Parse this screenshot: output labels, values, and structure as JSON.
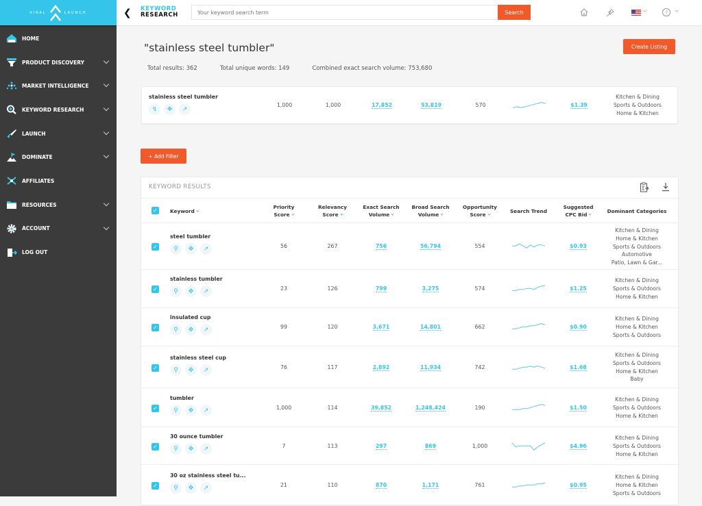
{
  "brand": {
    "logo_text_left": "VIRAL",
    "logo_text_right": "LAUNCH",
    "accent": "#36c5ea",
    "orange": "#f05a2a"
  },
  "sidebar": {
    "items": [
      {
        "label": "HOME",
        "icon": "home-icon",
        "has_children": false
      },
      {
        "label": "PRODUCT DISCOVERY",
        "icon": "funnel-icon",
        "has_children": true
      },
      {
        "label": "MARKET INTELLIGENCE",
        "icon": "network-icon",
        "has_children": true
      },
      {
        "label": "KEYWORD RESEARCH",
        "icon": "search-icon",
        "has_children": true
      },
      {
        "label": "LAUNCH",
        "icon": "rocket-icon",
        "has_children": true
      },
      {
        "label": "DOMINATE",
        "icon": "flag-mountain-icon",
        "has_children": true
      },
      {
        "label": "AFFILIATES",
        "icon": "affiliates-icon",
        "has_children": false
      },
      {
        "label": "RESOURCES",
        "icon": "folder-icon",
        "has_children": true
      },
      {
        "label": "ACCOUNT",
        "icon": "gear-icon",
        "has_children": true
      },
      {
        "label": "LOG OUT",
        "icon": "logout-icon",
        "has_children": false
      }
    ]
  },
  "topbar": {
    "title_line1": "KEYWORD",
    "title_line2": "RESEARCH",
    "search_placeholder": "Your keyword search term",
    "search_value": "",
    "search_button": "Search",
    "icons": [
      "home-icon",
      "pin-icon",
      "us-flag-icon",
      "help-icon"
    ]
  },
  "page": {
    "query": "\"stainless steel tumbler\"",
    "create_listing": "Create Listing",
    "stats": {
      "total_results": "Total results: 362",
      "unique_words": "Total unique words: 149",
      "combined_volume": "Combined exact search volume: 753,680"
    },
    "add_filter": "+ Add Filter"
  },
  "summary": {
    "keyword": "stainless steel tumbler",
    "priority": "1,000",
    "relevancy": "1,000",
    "exact": "17,852",
    "broad": "53,819",
    "opportunity": "570",
    "trend": [
      3,
      4,
      3,
      4,
      5,
      6,
      7,
      8,
      7
    ],
    "cpc": "$1.39",
    "categories": [
      "Kitchen & Dining",
      "Sports & Outdoors",
      "Home & Kitchen"
    ]
  },
  "results": {
    "title": "KEYWORD RESULTS",
    "columns": {
      "keyword": "Keyword",
      "priority_1": "Priority",
      "priority_2": "Score",
      "relevancy_1": "Relevancy",
      "relevancy_2": "Score",
      "exact_1": "Exact Search",
      "exact_2": "Volume",
      "broad_1": "Broad Search",
      "broad_2": "Volume",
      "opp_1": "Opportunity",
      "opp_2": "Score",
      "trend": "Search Trend",
      "cpc_1": "Suggested",
      "cpc_2": "CPC Bid",
      "categories": "Dominant Categories"
    },
    "rows": [
      {
        "keyword": "steel tumbler",
        "priority": "56",
        "relevancy": "267",
        "exact": "756",
        "broad": "56,794",
        "opportunity": "554",
        "cpc": "$0.93",
        "trend": [
          5,
          5,
          7,
          5,
          3,
          6,
          4,
          6,
          6,
          5
        ],
        "categories": [
          "Kitchen & Dining",
          "Home & Kitchen",
          "Sports & Outdoors",
          "Automotive",
          "Patio, Lawn & Gar..."
        ]
      },
      {
        "keyword": "stainless tumbler",
        "priority": "23",
        "relevancy": "126",
        "exact": "799",
        "broad": "3,275",
        "opportunity": "574",
        "cpc": "$1.25",
        "trend": [
          3,
          3,
          4,
          4,
          5,
          5,
          4,
          6,
          7,
          8
        ],
        "categories": [
          "Kitchen & Dining",
          "Sports & Outdoors",
          "Home & Kitchen"
        ]
      },
      {
        "keyword": "insulated cup",
        "priority": "99",
        "relevancy": "120",
        "exact": "3,671",
        "broad": "14,801",
        "opportunity": "662",
        "cpc": "$0.90",
        "trend": [
          3,
          3,
          4,
          5,
          5,
          6,
          6,
          7,
          8,
          7
        ],
        "categories": [
          "Kitchen & Dining",
          "Home & Kitchen",
          "Sports & Outdoors"
        ]
      },
      {
        "keyword": "stainless steel cup",
        "priority": "76",
        "relevancy": "117",
        "exact": "2,892",
        "broad": "11,934",
        "opportunity": "742",
        "cpc": "$1.68",
        "trend": [
          3,
          3,
          4,
          5,
          5,
          6,
          5,
          6,
          5,
          4
        ],
        "categories": [
          "Kitchen & Dining",
          "Sports & Outdoors",
          "Home & Kitchen",
          "Baby"
        ]
      },
      {
        "keyword": "tumbler",
        "priority": "1,000",
        "relevancy": "114",
        "exact": "39,852",
        "broad": "1,248,424",
        "opportunity": "190",
        "cpc": "$1.50",
        "trend": [
          3,
          3,
          3,
          4,
          4,
          5,
          6,
          7,
          8,
          7
        ],
        "categories": [
          "Kitchen & Dining",
          "Sports & Outdoors",
          "Home & Kitchen"
        ]
      },
      {
        "keyword": "30 ounce tumbler",
        "priority": "7",
        "relevancy": "113",
        "exact": "297",
        "broad": "869",
        "opportunity": "1,000",
        "cpc": "$4.96",
        "trend": [
          8,
          4,
          5,
          5,
          5,
          5,
          1,
          4,
          6,
          8
        ],
        "categories": [
          "Kitchen & Dining",
          "Sports & Outdoors",
          "Home & Kitchen"
        ]
      },
      {
        "keyword": "30 oz stainless steel tu...",
        "priority": "21",
        "relevancy": "110",
        "exact": "870",
        "broad": "1,171",
        "opportunity": "761",
        "cpc": "$0.95",
        "trend": [
          3,
          3,
          4,
          4,
          5,
          5,
          5,
          6,
          6,
          7
        ],
        "categories": [
          "Kitchen & Dining",
          "Home & Kitchen",
          "Sports & Outdoors"
        ]
      }
    ]
  }
}
